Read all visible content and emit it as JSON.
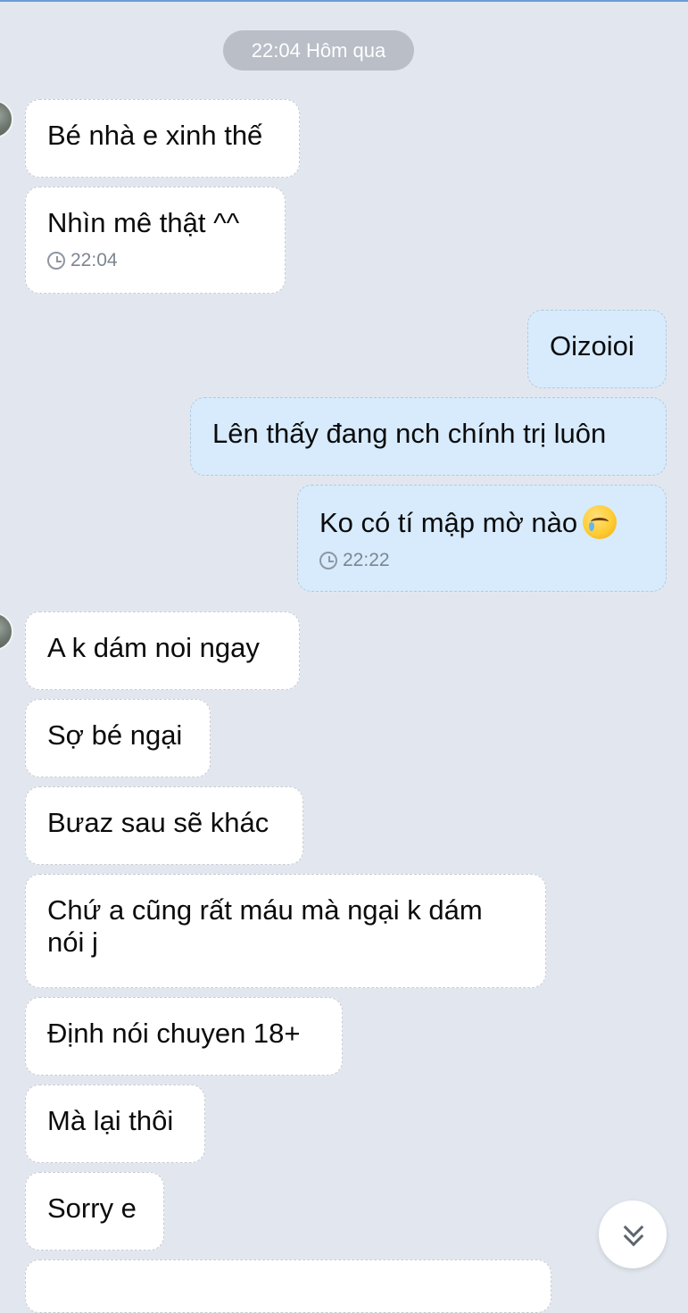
{
  "header": {
    "date_separator": "22:04 Hôm qua"
  },
  "messages": [
    {
      "direction": "in",
      "text": "Bé nhà e xinh thế"
    },
    {
      "direction": "in",
      "text": "Nhìn mê thật ^^",
      "time": "22:04"
    },
    {
      "direction": "out",
      "text": "Oizoioi"
    },
    {
      "direction": "out",
      "text": "Lên thấy đang nch chính trị luôn"
    },
    {
      "direction": "out",
      "text": "Ko có tí mập mờ nào",
      "emoji": "crying-face-emoji",
      "time": "22:22"
    },
    {
      "direction": "in",
      "text": "A k dám noi ngay"
    },
    {
      "direction": "in",
      "text": "Sợ bé ngại"
    },
    {
      "direction": "in",
      "text": "Bưaz sau sẽ khác"
    },
    {
      "direction": "in",
      "text": "Chứ a cũng rất máu mà ngại k dám nói j"
    },
    {
      "direction": "in",
      "text": "Định nói chuyen 18+"
    },
    {
      "direction": "in",
      "text": "Mà lại thôi"
    },
    {
      "direction": "in",
      "text": "Sorry e"
    },
    {
      "direction": "in",
      "text": ""
    }
  ],
  "controls": {
    "scroll_down_icon": "double-chevron-down-icon"
  },
  "colors": {
    "background": "#e2e7ef",
    "incoming_bubble": "#ffffff",
    "outgoing_bubble": "#d7ebfd",
    "time_pill": "#b9bec7"
  }
}
